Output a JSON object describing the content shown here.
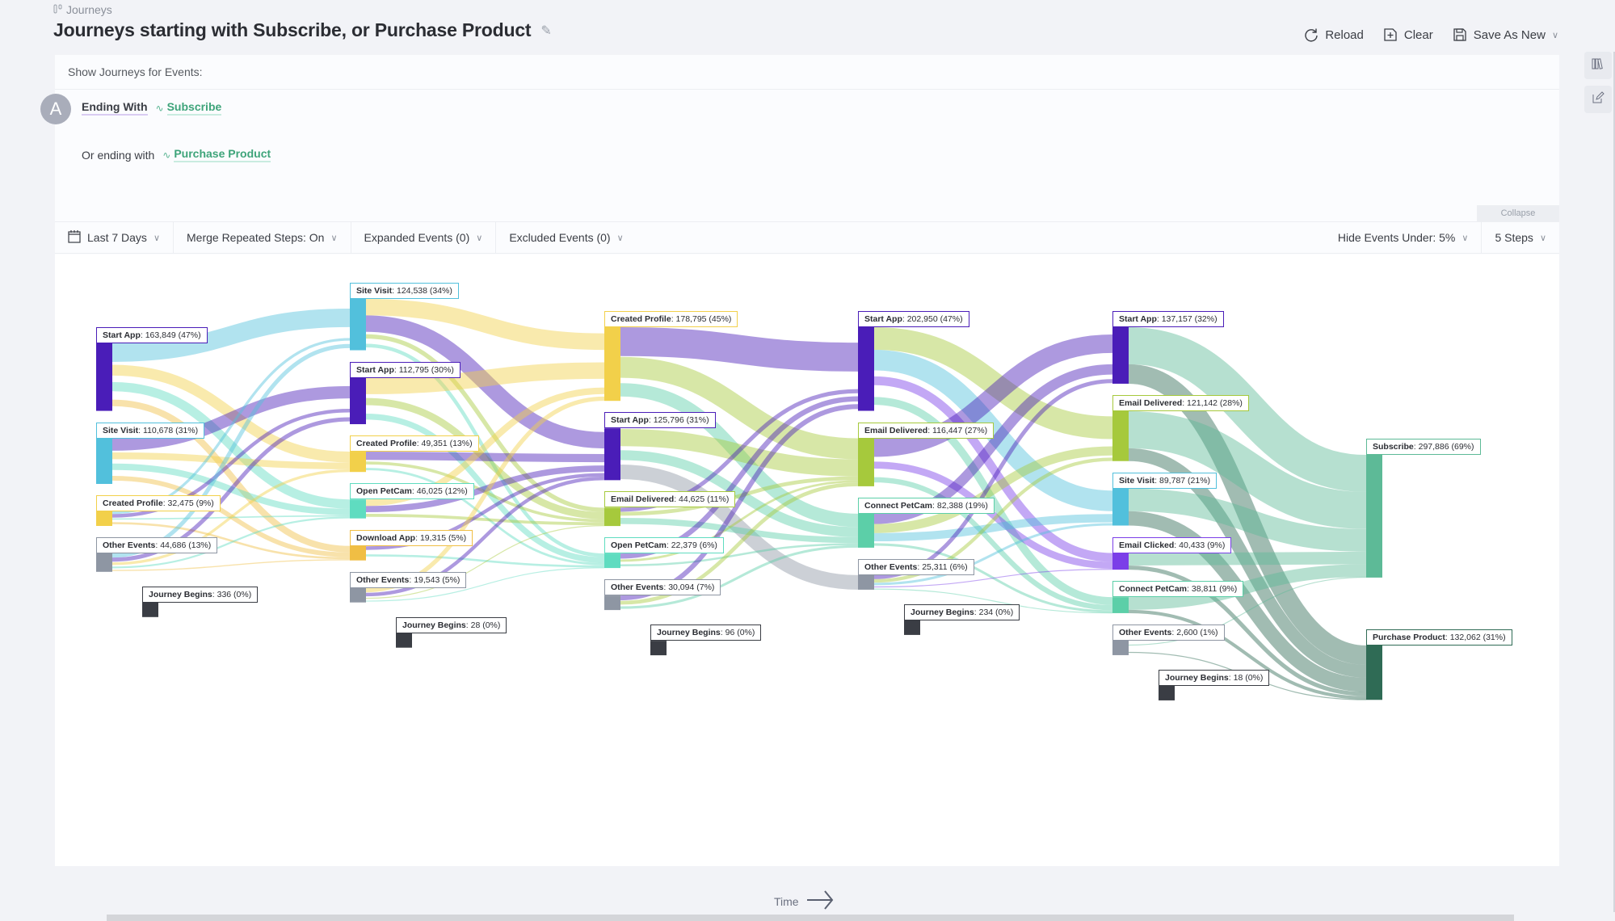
{
  "breadcrumb": {
    "icon": "journeys-icon",
    "label": "Journeys"
  },
  "title": "Journeys starting with Subscribe, or Purchase Product",
  "actions": {
    "reload": "Reload",
    "clear": "Clear",
    "save_as_new": "Save As New"
  },
  "query": {
    "header": "Show Journeys for Events:",
    "avatar_letter": "A",
    "ending_with_label": "Ending With",
    "event_1": "Subscribe",
    "or_ending_label": "Or ending with",
    "event_2": "Purchase Product",
    "collapse": "Collapse"
  },
  "controls": {
    "date_range": "Last 7 Days",
    "merge": "Merge Repeated Steps: On",
    "expanded": "Expanded Events (0)",
    "excluded": "Excluded Events (0)",
    "hide_under": "Hide Events Under: 5%",
    "steps": "5 Steps"
  },
  "time_label": "Time",
  "chart_data": {
    "type": "sankey",
    "colors": {
      "Start App": "#4a1db8",
      "Site Visit": "#52c0dc",
      "Created Profile": "#f2d04a",
      "Other Events": "#8e96a3",
      "Journey Begins": "#3a3d44",
      "Open PetCam": "#5fdcc0",
      "Download App": "#f0be44",
      "Email Delivered": "#a6c93c",
      "Connect PetCam": "#5ccfa8",
      "Email Clicked": "#7b3fe8",
      "Subscribe": "#5dba97",
      "Purchase Product": "#2f6b55"
    },
    "columns": [
      [
        {
          "id": "c0_sa",
          "name": "Start App",
          "value": "163,849",
          "pct": "47%"
        },
        {
          "id": "c0_sv",
          "name": "Site Visit",
          "value": "110,678",
          "pct": "31%"
        },
        {
          "id": "c0_cp",
          "name": "Created Profile",
          "value": "32,475",
          "pct": "9%"
        },
        {
          "id": "c0_oe",
          "name": "Other Events",
          "value": "44,686",
          "pct": "13%"
        },
        {
          "id": "c0_jb",
          "name": "Journey Begins",
          "value": "336",
          "pct": "0%"
        }
      ],
      [
        {
          "id": "c1_sv",
          "name": "Site Visit",
          "value": "124,538",
          "pct": "34%"
        },
        {
          "id": "c1_sa",
          "name": "Start App",
          "value": "112,795",
          "pct": "30%"
        },
        {
          "id": "c1_cp",
          "name": "Created Profile",
          "value": "49,351",
          "pct": "13%"
        },
        {
          "id": "c1_op",
          "name": "Open PetCam",
          "value": "46,025",
          "pct": "12%"
        },
        {
          "id": "c1_da",
          "name": "Download App",
          "value": "19,315",
          "pct": "5%"
        },
        {
          "id": "c1_oe",
          "name": "Other Events",
          "value": "19,543",
          "pct": "5%"
        },
        {
          "id": "c1_jb",
          "name": "Journey Begins",
          "value": "28",
          "pct": "0%"
        }
      ],
      [
        {
          "id": "c2_cp",
          "name": "Created Profile",
          "value": "178,795",
          "pct": "45%"
        },
        {
          "id": "c2_sa",
          "name": "Start App",
          "value": "125,796",
          "pct": "31%"
        },
        {
          "id": "c2_ed",
          "name": "Email Delivered",
          "value": "44,625",
          "pct": "11%"
        },
        {
          "id": "c2_op",
          "name": "Open PetCam",
          "value": "22,379",
          "pct": "6%"
        },
        {
          "id": "c2_oe",
          "name": "Other Events",
          "value": "30,094",
          "pct": "7%"
        },
        {
          "id": "c2_jb",
          "name": "Journey Begins",
          "value": "96",
          "pct": "0%"
        }
      ],
      [
        {
          "id": "c3_sa",
          "name": "Start App",
          "value": "202,950",
          "pct": "47%"
        },
        {
          "id": "c3_ed",
          "name": "Email Delivered",
          "value": "116,447",
          "pct": "27%"
        },
        {
          "id": "c3_cpc",
          "name": "Connect PetCam",
          "value": "82,388",
          "pct": "19%"
        },
        {
          "id": "c3_oe",
          "name": "Other Events",
          "value": "25,311",
          "pct": "6%"
        },
        {
          "id": "c3_jb",
          "name": "Journey Begins",
          "value": "234",
          "pct": "0%"
        }
      ],
      [
        {
          "id": "c4_sa",
          "name": "Start App",
          "value": "137,157",
          "pct": "32%"
        },
        {
          "id": "c4_ed",
          "name": "Email Delivered",
          "value": "121,142",
          "pct": "28%"
        },
        {
          "id": "c4_sv",
          "name": "Site Visit",
          "value": "89,787",
          "pct": "21%"
        },
        {
          "id": "c4_ec",
          "name": "Email Clicked",
          "value": "40,433",
          "pct": "9%"
        },
        {
          "id": "c4_cpc",
          "name": "Connect PetCam",
          "value": "38,811",
          "pct": "9%"
        },
        {
          "id": "c4_oe",
          "name": "Other Events",
          "value": "2,600",
          "pct": "1%"
        },
        {
          "id": "c4_jb",
          "name": "Journey Begins",
          "value": "18",
          "pct": "0%"
        }
      ],
      [
        {
          "id": "c5_sub",
          "name": "Subscribe",
          "value": "297,886",
          "pct": "69%"
        },
        {
          "id": "c5_pp",
          "name": "Purchase Product",
          "value": "132,062",
          "pct": "31%"
        }
      ]
    ],
    "links": [
      {
        "s": "c0_sa",
        "t": "c1_sv",
        "v": 45000
      },
      {
        "s": "c0_sa",
        "t": "c1_cp",
        "v": 40000
      },
      {
        "s": "c0_sa",
        "t": "c1_op",
        "v": 40000
      },
      {
        "s": "c0_sa",
        "t": "c1_da",
        "v": 38849
      },
      {
        "s": "c0_sv",
        "t": "c1_sa",
        "v": 30000
      },
      {
        "s": "c0_sv",
        "t": "c1_cp",
        "v": 25000
      },
      {
        "s": "c0_sv",
        "t": "c1_op",
        "v": 28000
      },
      {
        "s": "c0_sv",
        "t": "c1_da",
        "v": 27678
      },
      {
        "s": "c0_cp",
        "t": "c1_sv",
        "v": 6000
      },
      {
        "s": "c0_cp",
        "t": "c1_sa",
        "v": 8000
      },
      {
        "s": "c0_cp",
        "t": "c1_op",
        "v": 6000
      },
      {
        "s": "c0_cp",
        "t": "c1_da",
        "v": 12475
      },
      {
        "s": "c0_oe",
        "t": "c1_sv",
        "v": 10000
      },
      {
        "s": "c0_oe",
        "t": "c1_sa",
        "v": 10000
      },
      {
        "s": "c0_oe",
        "t": "c1_cp",
        "v": 10000
      },
      {
        "s": "c0_oe",
        "t": "c1_op",
        "v": 8000
      },
      {
        "s": "c0_oe",
        "t": "c1_da",
        "v": 6686
      },
      {
        "s": "c1_sv",
        "t": "c2_cp",
        "v": 40000
      },
      {
        "s": "c1_sv",
        "t": "c2_sa",
        "v": 40000
      },
      {
        "s": "c1_sv",
        "t": "c2_ed",
        "v": 22000
      },
      {
        "s": "c1_sv",
        "t": "c2_op",
        "v": 22538
      },
      {
        "s": "c1_sa",
        "t": "c2_cp",
        "v": 40000
      },
      {
        "s": "c1_sa",
        "t": "c2_ed",
        "v": 36000
      },
      {
        "s": "c1_sa",
        "t": "c2_op",
        "v": 36795
      },
      {
        "s": "c1_cp",
        "t": "c2_sa",
        "v": 20000
      },
      {
        "s": "c1_cp",
        "t": "c2_ed",
        "v": 15000
      },
      {
        "s": "c1_cp",
        "t": "c2_op",
        "v": 14351
      },
      {
        "s": "c1_op",
        "t": "c2_cp",
        "v": 16000
      },
      {
        "s": "c1_op",
        "t": "c2_sa",
        "v": 15000
      },
      {
        "s": "c1_op",
        "t": "c2_ed",
        "v": 15025
      },
      {
        "s": "c1_da",
        "t": "c2_sa",
        "v": 6000
      },
      {
        "s": "c1_da",
        "t": "c2_op",
        "v": 13315
      },
      {
        "s": "c1_oe",
        "t": "c2_cp",
        "v": 6000
      },
      {
        "s": "c1_oe",
        "t": "c2_sa",
        "v": 6000
      },
      {
        "s": "c1_oe",
        "t": "c2_ed",
        "v": 4000
      },
      {
        "s": "c1_oe",
        "t": "c2_op",
        "v": 3543
      },
      {
        "s": "c2_cp",
        "t": "c3_sa",
        "v": 70000
      },
      {
        "s": "c2_cp",
        "t": "c3_ed",
        "v": 55000
      },
      {
        "s": "c2_cp",
        "t": "c3_cpc",
        "v": 53795
      },
      {
        "s": "c2_sa",
        "t": "c3_ed",
        "v": 45000
      },
      {
        "s": "c2_sa",
        "t": "c3_cpc",
        "v": 40000
      },
      {
        "s": "c2_sa",
        "t": "c3_oe",
        "v": 40796
      },
      {
        "s": "c2_ed",
        "t": "c3_sa",
        "v": 10000
      },
      {
        "s": "c2_ed",
        "t": "c3_ed",
        "v": 10000
      },
      {
        "s": "c2_ed",
        "t": "c3_cpc",
        "v": 24625
      },
      {
        "s": "c2_op",
        "t": "c3_sa",
        "v": 8000
      },
      {
        "s": "c2_op",
        "t": "c3_ed",
        "v": 6000
      },
      {
        "s": "c2_op",
        "t": "c3_cpc",
        "v": 8379
      },
      {
        "s": "c2_oe",
        "t": "c3_sa",
        "v": 10000
      },
      {
        "s": "c2_oe",
        "t": "c3_ed",
        "v": 10000
      },
      {
        "s": "c2_oe",
        "t": "c3_cpc",
        "v": 10094
      },
      {
        "s": "c3_sa",
        "t": "c4_ed",
        "v": 55000
      },
      {
        "s": "c3_sa",
        "t": "c4_sv",
        "v": 50000
      },
      {
        "s": "c3_sa",
        "t": "c4_ec",
        "v": 50000
      },
      {
        "s": "c3_sa",
        "t": "c4_cpc",
        "v": 47950
      },
      {
        "s": "c3_ed",
        "t": "c4_sa",
        "v": 45000
      },
      {
        "s": "c3_ed",
        "t": "c4_ec",
        "v": 40000
      },
      {
        "s": "c3_ed",
        "t": "c4_cpc",
        "v": 31447
      },
      {
        "s": "c3_cpc",
        "t": "c4_sa",
        "v": 25000
      },
      {
        "s": "c3_cpc",
        "t": "c4_ed",
        "v": 22000
      },
      {
        "s": "c3_cpc",
        "t": "c4_sv",
        "v": 20000
      },
      {
        "s": "c3_cpc",
        "t": "c4_cpc",
        "v": 15388
      },
      {
        "s": "c3_oe",
        "t": "c4_sa",
        "v": 7000
      },
      {
        "s": "c3_oe",
        "t": "c4_ed",
        "v": 6000
      },
      {
        "s": "c3_oe",
        "t": "c4_sv",
        "v": 5000
      },
      {
        "s": "c3_oe",
        "t": "c4_ec",
        "v": 5000
      },
      {
        "s": "c3_oe",
        "t": "c4_cpc",
        "v": 2311
      },
      {
        "s": "c4_sa",
        "t": "c5_sub",
        "v": 90000
      },
      {
        "s": "c4_sa",
        "t": "c5_pp",
        "v": 47157
      },
      {
        "s": "c4_ed",
        "t": "c5_sub",
        "v": 90000
      },
      {
        "s": "c4_ed",
        "t": "c5_pp",
        "v": 31142
      },
      {
        "s": "c4_sv",
        "t": "c5_sub",
        "v": 55000
      },
      {
        "s": "c4_sv",
        "t": "c5_pp",
        "v": 34787
      },
      {
        "s": "c4_ec",
        "t": "c5_sub",
        "v": 30433
      },
      {
        "s": "c4_ec",
        "t": "c5_pp",
        "v": 10000
      },
      {
        "s": "c4_cpc",
        "t": "c5_sub",
        "v": 30811
      },
      {
        "s": "c4_cpc",
        "t": "c5_pp",
        "v": 8000
      },
      {
        "s": "c4_oe",
        "t": "c5_sub",
        "v": 1600
      },
      {
        "s": "c4_oe",
        "t": "c5_pp",
        "v": 1000
      }
    ]
  }
}
